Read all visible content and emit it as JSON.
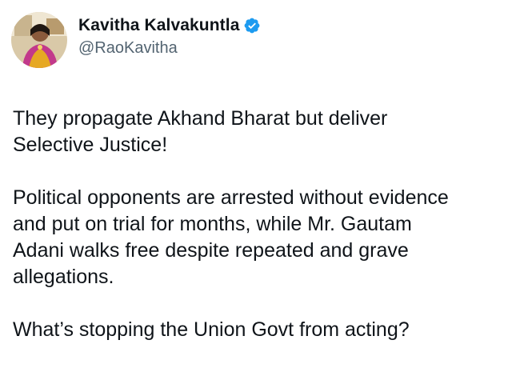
{
  "author": {
    "display_name": "Kavitha Kalvakuntla",
    "handle": "@RaoKavitha",
    "verified": true,
    "verified_color": "#1d9bf0"
  },
  "tweet": {
    "paragraphs": [
      {
        "lines": [
          "They propagate Akhand Bharat but deliver",
          "Selective Justice!"
        ]
      },
      {
        "lines": [
          "Political opponents are arrested without evidence",
          "and put on trial for months, while Mr. Gautam",
          "Adani walks free despite repeated and grave",
          "allegations."
        ]
      },
      {
        "lines": [
          "What’s stopping the Union Govt from acting?"
        ]
      }
    ]
  },
  "icons": {
    "verified": "verified-badge-icon",
    "avatar": "profile-photo"
  }
}
